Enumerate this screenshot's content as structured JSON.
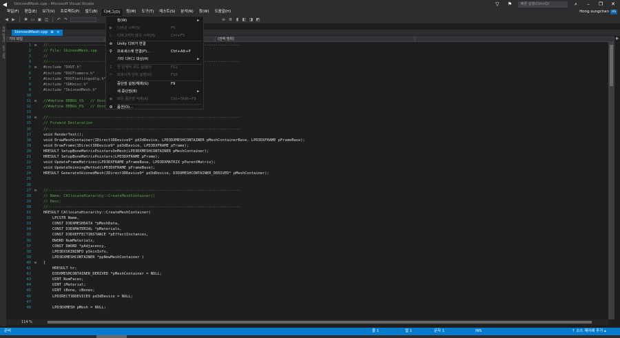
{
  "window": {
    "title": "SkinnedMesh.cpp - Microsoft Visual Studio",
    "quick_launch": "빠른 실행(Ctrl+Q)",
    "user": "Hong sungchan",
    "user_initials": "HS"
  },
  "menu": [
    "파일(F)",
    "편집(E)",
    "보기(V)",
    "프로젝트(P)",
    "빌드(B)",
    "디버그(D)",
    "팀(M)",
    "도구(T)",
    "테스트(S)",
    "분석(N)",
    "창(W)",
    "도움말(H)"
  ],
  "left_strip": [
    "서버 탐색기",
    "도구 상자"
  ],
  "tab": {
    "label": "SkinnedMesh.cpp",
    "pin": "⊕",
    "close": "×"
  },
  "navbar": {
    "project": "기타 파일",
    "scope": "(전역 범위)"
  },
  "debug_menu": [
    {
      "icon": "",
      "label": "창(W)",
      "shortcut": "",
      "arrow": "▸",
      "disabled": false
    },
    {
      "icon": "▶",
      "label": "디버깅 시작(S)",
      "shortcut": "F5",
      "arrow": "",
      "disabled": true
    },
    {
      "icon": "▷",
      "label": "디버그하지 않고 시작(H)",
      "shortcut": "Ctrl+F5",
      "arrow": "",
      "disabled": true
    },
    {
      "icon": "⊚",
      "label": "Unity 디버거 연결",
      "shortcut": "",
      "arrow": "",
      "disabled": false
    },
    {
      "icon": "⚲",
      "label": "프로세스에 연결(P)...",
      "shortcut": "Ctrl+Alt+P",
      "arrow": "",
      "disabled": false
    },
    {
      "icon": "",
      "label": "기타 디버그 대상(H)",
      "shortcut": "",
      "arrow": "▸",
      "disabled": false
    },
    {
      "icon": "↧",
      "label": "한 단계씩 코드 실행(I)",
      "shortcut": "F11",
      "arrow": "",
      "disabled": true
    },
    {
      "icon": "↷",
      "label": "프로시저 단위 실행(O)",
      "shortcut": "F10",
      "arrow": "",
      "disabled": true
    },
    {
      "icon": "",
      "label": "중단점 설정/해제(G)",
      "shortcut": "F9",
      "arrow": "",
      "disabled": false
    },
    {
      "icon": "",
      "label": "새 중단점(B)",
      "shortcut": "",
      "arrow": "▸",
      "disabled": false
    },
    {
      "icon": "◉",
      "label": "모든 중단점 삭제(A)",
      "shortcut": "Ctrl+Shift+F9",
      "arrow": "",
      "disabled": true
    },
    {
      "icon": "⚙",
      "label": "옵션(O)...",
      "shortcut": "",
      "arrow": "",
      "disabled": false
    }
  ],
  "code_lines": [
    {
      "n": "1",
      "fold": "⊟",
      "text": "//--------------------------------------------------------------------------------------",
      "c": "#57a64a"
    },
    {
      "n": "2",
      "fold": "",
      "text": "// File: SkinnedMesh.cpp",
      "c": "#57a64a"
    },
    {
      "n": "3",
      "fold": "",
      "text": "//",
      "c": "#57a64a"
    },
    {
      "n": "4",
      "fold": "",
      "text": "//--------------------------------------------------------------------------------------",
      "c": "#57a64a"
    },
    {
      "n": "5",
      "fold": "⊟",
      "text": "#include \"DXUT.h\"",
      "c": "#9b9b9b"
    },
    {
      "n": "6",
      "fold": "",
      "text": "#include \"DXUTcamera.h\"",
      "c": "#9b9b9b"
    },
    {
      "n": "7",
      "fold": "",
      "text": "#include \"DXUTsettingsdlg.h\"",
      "c": "#9b9b9b"
    },
    {
      "n": "8",
      "fold": "",
      "text": "#include \"SDKmisc.h\"",
      "c": "#9b9b9b"
    },
    {
      "n": "9",
      "fold": "",
      "text": "#include \"SkinnedMesh.h\"",
      "c": "#9b9b9b"
    },
    {
      "n": "10",
      "fold": "",
      "text": "",
      "c": "#dcdcdc"
    },
    {
      "n": "11",
      "fold": "⊟",
      "text": "//#define DEBUG_VS   // Uncomment this line to debug vertex shaders",
      "c": "#57a64a"
    },
    {
      "n": "12",
      "fold": "",
      "text": "//#define DEBUG_PS   // Uncomment this line to debug pixel shaders",
      "c": "#57a64a"
    },
    {
      "n": "13",
      "fold": "",
      "text": "",
      "c": "#dcdcdc"
    },
    {
      "n": "14",
      "fold": "⊟",
      "text": "//--------------------------------------------------------------------------------------",
      "c": "#57a64a"
    },
    {
      "n": "15",
      "fold": "",
      "text": "// Forward Declaration",
      "c": "#57a64a"
    },
    {
      "n": "16",
      "fold": "",
      "text": "//--------------------------------------------------------------------------------------",
      "c": "#57a64a"
    },
    {
      "n": "17",
      "fold": "",
      "text": "void RenderText();",
      "c": "#dcdcdc"
    },
    {
      "n": "18",
      "fold": "",
      "text": "void DrawMeshContainer(IDirect3DDevice9* pd3dDevice, LPD3DXMESHCONTAINER pMeshContainerBase, LPD3DXFRAME pFrameBase);",
      "c": "#dcdcdc"
    },
    {
      "n": "19",
      "fold": "",
      "text": "void DrawFrame(IDirect3DDevice9* pd3dDevice, LPD3DXFRAME pFrame);",
      "c": "#dcdcdc"
    },
    {
      "n": "20",
      "fold": "",
      "text": "HRESULT SetupBoneMatrixPointersOnMesh(LPD3DXMESHCONTAINER pMeshContainer);",
      "c": "#dcdcdc"
    },
    {
      "n": "21",
      "fold": "",
      "text": "HRESULT SetupBoneMatrixPointers(LPD3DXFRAME pFrame);",
      "c": "#dcdcdc"
    },
    {
      "n": "22",
      "fold": "",
      "text": "void UpdateFrameMatrices(LPD3DXFRAME pFrameBase, LPD3DXMATRIX pParentMatrix);",
      "c": "#dcdcdc"
    },
    {
      "n": "23",
      "fold": "",
      "text": "void UpdateSkinningMethod(LPD3DXFRAME pFrameBase);",
      "c": "#dcdcdc"
    },
    {
      "n": "24",
      "fold": "",
      "text": "HRESULT GenerateSkinnedMesh(IDirect3DDevice9* pd3dDevice, D3DXMESHCONTAINER_DERIVED* pMeshContainer);",
      "c": "#dcdcdc"
    },
    {
      "n": "25",
      "fold": "",
      "text": "",
      "c": "#dcdcdc"
    },
    {
      "n": "26",
      "fold": "",
      "text": "",
      "c": "#dcdcdc"
    },
    {
      "n": "27",
      "fold": "⊟",
      "text": "//--------------------------------------------------------------------------------------",
      "c": "#57a64a"
    },
    {
      "n": "28",
      "fold": "",
      "text": "// Name: CAllocateHierarchy::CreateMeshContainer()",
      "c": "#57a64a"
    },
    {
      "n": "29",
      "fold": "",
      "text": "// Desc:",
      "c": "#57a64a"
    },
    {
      "n": "30",
      "fold": "",
      "text": "//--------------------------------------------------------------------------------------",
      "c": "#57a64a"
    },
    {
      "n": "31",
      "fold": "",
      "text": "HRESULT CAllocateHierarchy::CreateMeshContainer(",
      "c": "#dcdcdc"
    },
    {
      "n": "32",
      "fold": "",
      "text": "    LPCSTR Name,",
      "c": "#dcdcdc"
    },
    {
      "n": "33",
      "fold": "",
      "text": "    CONST D3DXMESHDATA *pMeshData,",
      "c": "#dcdcdc"
    },
    {
      "n": "34",
      "fold": "",
      "text": "    CONST D3DXMATERIAL *pMaterials,",
      "c": "#dcdcdc"
    },
    {
      "n": "35",
      "fold": "",
      "text": "    CONST D3DXEFFECTINSTANCE *pEffectInstances,",
      "c": "#dcdcdc"
    },
    {
      "n": "36",
      "fold": "",
      "text": "    DWORD NumMaterials,",
      "c": "#dcdcdc"
    },
    {
      "n": "37",
      "fold": "",
      "text": "    CONST DWORD *pAdjacency,",
      "c": "#dcdcdc"
    },
    {
      "n": "38",
      "fold": "",
      "text": "    LPD3DXSKININFO pSkinInfo,",
      "c": "#dcdcdc"
    },
    {
      "n": "39",
      "fold": "",
      "text": "    LPD3DXMESHCONTAINER *ppNewMeshContainer )",
      "c": "#dcdcdc"
    },
    {
      "n": "40",
      "fold": "⊟",
      "text": "{",
      "c": "#dcdcdc"
    },
    {
      "n": "41",
      "fold": "",
      "text": "    HRESULT hr;",
      "c": "#dcdcdc"
    },
    {
      "n": "42",
      "fold": "",
      "text": "    D3DXMESHCONTAINER_DERIVED *pMeshContainer = NULL;",
      "c": "#dcdcdc"
    },
    {
      "n": "43",
      "fold": "",
      "text": "    UINT NumFaces;",
      "c": "#dcdcdc"
    },
    {
      "n": "44",
      "fold": "",
      "text": "    UINT iMaterial;",
      "c": "#dcdcdc"
    },
    {
      "n": "45",
      "fold": "",
      "text": "    UINT iBone, cBones;",
      "c": "#dcdcdc"
    },
    {
      "n": "46",
      "fold": "",
      "text": "    LPDIRECT3DDEVICE9 pd3dDevice = NULL;",
      "c": "#dcdcdc"
    },
    {
      "n": "47",
      "fold": "",
      "text": "",
      "c": "#dcdcdc"
    },
    {
      "n": "48",
      "fold": "",
      "text": "    LPD3DXMESH pMesh = NULL;",
      "c": "#dcdcdc"
    }
  ],
  "zoom": "114 %",
  "status": {
    "ready": "준비",
    "line": "줄 1",
    "col": "열 1",
    "char": "문자 1",
    "mode": "INS",
    "source_control": "↑ 소스 제어에 추가 ▴"
  }
}
